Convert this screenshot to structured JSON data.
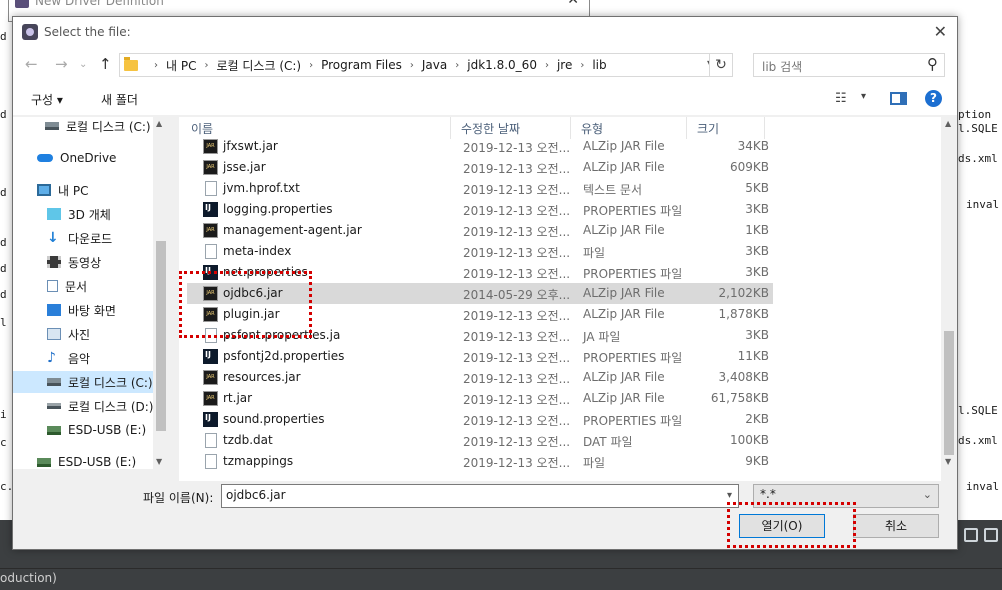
{
  "background": {
    "left_code": [
      "d",
      "d",
      "d",
      "d",
      "d",
      "d",
      "l",
      "i",
      "c",
      "c."
    ],
    "right_code": [
      "ption",
      "l.SQLE",
      "ds.xml",
      "inval",
      "l.SQLE",
      "ds.xml",
      "inval"
    ],
    "status_text": "oduction)"
  },
  "behind_window": {
    "title": "New Driver Definition"
  },
  "dialog": {
    "title": "Select the file:",
    "address": [
      "내 PC",
      "로컬 디스크 (C:)",
      "Program Files",
      "Java",
      "jdk1.8.0_60",
      "jre",
      "lib"
    ],
    "search_placeholder": "lib 검색",
    "toolbar": {
      "organize": "구성 ▾",
      "new_folder": "새 폴더"
    },
    "nav_items": [
      {
        "label": "로컬 디스크 (C:)",
        "icon": "drive-icon"
      },
      {
        "label": "OneDrive",
        "icon": "cloud-icon"
      },
      {
        "label": "내 PC",
        "icon": "computer-icon"
      },
      {
        "label": "3D 개체",
        "icon": "cube-icon"
      },
      {
        "label": "다운로드",
        "icon": "download-icon"
      },
      {
        "label": "동영상",
        "icon": "video-icon"
      },
      {
        "label": "문서",
        "icon": "document-icon"
      },
      {
        "label": "바탕 화면",
        "icon": "desktop-icon"
      },
      {
        "label": "사진",
        "icon": "picture-icon"
      },
      {
        "label": "음악",
        "icon": "music-icon"
      },
      {
        "label": "로컬 디스크 (C:)",
        "icon": "drive-icon"
      },
      {
        "label": "로컬 디스크 (D:)",
        "icon": "drive-icon"
      },
      {
        "label": "ESD-USB (E:)",
        "icon": "usb-icon"
      },
      {
        "label": "ESD-USB (E:)",
        "icon": "usb-icon"
      }
    ],
    "columns": [
      "이름",
      "수정한 날짜",
      "유형",
      "크기"
    ],
    "files": [
      {
        "name": "jfxswt.jar",
        "date": "2019-12-13 오전...",
        "type": "ALZip JAR File",
        "size": "34KB",
        "icon": "jar"
      },
      {
        "name": "jsse.jar",
        "date": "2019-12-13 오전...",
        "type": "ALZip JAR File",
        "size": "609KB",
        "icon": "jar"
      },
      {
        "name": "jvm.hprof.txt",
        "date": "2019-12-13 오전...",
        "type": "텍스트 문서",
        "size": "5KB",
        "icon": "doc"
      },
      {
        "name": "logging.properties",
        "date": "2019-12-13 오전...",
        "type": "PROPERTIES 파일",
        "size": "3KB",
        "icon": "prop"
      },
      {
        "name": "management-agent.jar",
        "date": "2019-12-13 오전...",
        "type": "ALZip JAR File",
        "size": "1KB",
        "icon": "jar"
      },
      {
        "name": "meta-index",
        "date": "2019-12-13 오전...",
        "type": "파일",
        "size": "3KB",
        "icon": "doc"
      },
      {
        "name": "net.properties",
        "date": "2019-12-13 오전...",
        "type": "PROPERTIES 파일",
        "size": "3KB",
        "icon": "prop"
      },
      {
        "name": "ojdbc6.jar",
        "date": "2014-05-29 오후...",
        "type": "ALZip JAR File",
        "size": "2,102KB",
        "icon": "jar"
      },
      {
        "name": "plugin.jar",
        "date": "2019-12-13 오전...",
        "type": "ALZip JAR File",
        "size": "1,878KB",
        "icon": "jar"
      },
      {
        "name": "psfont.properties.ja",
        "date": "2019-12-13 오전...",
        "type": "JA 파일",
        "size": "3KB",
        "icon": "doc"
      },
      {
        "name": "psfontj2d.properties",
        "date": "2019-12-13 오전...",
        "type": "PROPERTIES 파일",
        "size": "11KB",
        "icon": "prop"
      },
      {
        "name": "resources.jar",
        "date": "2019-12-13 오전...",
        "type": "ALZip JAR File",
        "size": "3,408KB",
        "icon": "jar"
      },
      {
        "name": "rt.jar",
        "date": "2019-12-13 오전...",
        "type": "ALZip JAR File",
        "size": "61,758KB",
        "icon": "jar"
      },
      {
        "name": "sound.properties",
        "date": "2019-12-13 오전...",
        "type": "PROPERTIES 파일",
        "size": "2KB",
        "icon": "prop"
      },
      {
        "name": "tzdb.dat",
        "date": "2019-12-13 오전...",
        "type": "DAT 파일",
        "size": "100KB",
        "icon": "doc"
      },
      {
        "name": "tzmappings",
        "date": "2019-12-13 오전...",
        "type": "파일",
        "size": "9KB",
        "icon": "doc"
      }
    ],
    "selected_file": "ojdbc6.jar",
    "filename_label": "파일 이름(N):",
    "filename_value": "ojdbc6.jar",
    "filter_value": "*.*",
    "open_button": "열기(O)",
    "cancel_button": "취소",
    "colors": {
      "annotation": "#d40000",
      "selection": "#d9d9d9",
      "help": "#1c6fd1"
    }
  }
}
